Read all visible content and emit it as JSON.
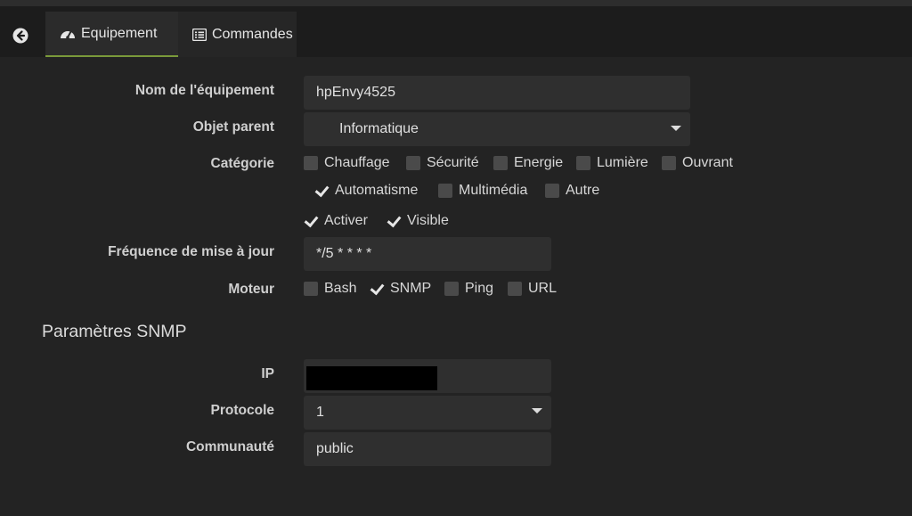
{
  "tabs": [
    {
      "label": "Equipement",
      "icon": "dashboard-icon"
    },
    {
      "label": "Commandes",
      "icon": "list-icon"
    }
  ],
  "form": {
    "name_label": "Nom de l'équipement",
    "name_value": "hpEnvy4525",
    "parent_label": "Objet parent",
    "parent_value": "Informatique",
    "category_label": "Catégorie",
    "categories": [
      {
        "label": "Chauffage",
        "checked": false
      },
      {
        "label": "Sécurité",
        "checked": false
      },
      {
        "label": "Energie",
        "checked": false
      },
      {
        "label": "Lumière",
        "checked": false
      },
      {
        "label": "Ouvrant",
        "checked": false
      },
      {
        "label": "Automatisme",
        "checked": true
      },
      {
        "label": "Multimédia",
        "checked": false
      },
      {
        "label": "Autre",
        "checked": false
      }
    ],
    "options": [
      {
        "label": "Activer",
        "checked": true
      },
      {
        "label": "Visible",
        "checked": true
      }
    ],
    "frequency_label": "Fréquence de mise à jour",
    "frequency_value": "*/5 * * * *",
    "engine_label": "Moteur",
    "engines": [
      {
        "label": "Bash",
        "checked": false
      },
      {
        "label": "SNMP",
        "checked": true
      },
      {
        "label": "Ping",
        "checked": false
      },
      {
        "label": "URL",
        "checked": false
      }
    ]
  },
  "snmp": {
    "section_title": "Paramètres SNMP",
    "ip_label": "IP",
    "protocol_label": "Protocole",
    "protocol_value": "1",
    "community_label": "Communauté",
    "community_value": "public"
  }
}
